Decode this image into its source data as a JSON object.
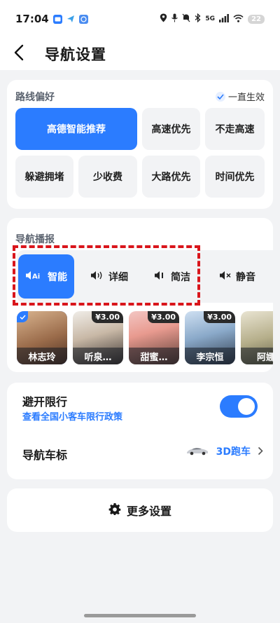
{
  "status": {
    "time": "17:04",
    "network": "5G",
    "battery": "22"
  },
  "header": {
    "title": "导航设置"
  },
  "route": {
    "section_title": "路线偏好",
    "always_on_label": "一直生效",
    "options": [
      {
        "label": "高德智能推荐",
        "active": true
      },
      {
        "label": "高速优先",
        "active": false
      },
      {
        "label": "不走高速",
        "active": false
      },
      {
        "label": "躲避拥堵",
        "active": false
      },
      {
        "label": "少收费",
        "active": false
      },
      {
        "label": "大路优先",
        "active": false
      },
      {
        "label": "时间优先",
        "active": false
      }
    ]
  },
  "broadcast": {
    "section_title": "导航播报",
    "modes": [
      {
        "label": "智能",
        "icon": "ai-speaker-icon",
        "active": true
      },
      {
        "label": "详细",
        "icon": "speaker-loud-icon",
        "active": false
      },
      {
        "label": "简洁",
        "icon": "speaker-low-icon",
        "active": false
      },
      {
        "label": "静音",
        "icon": "speaker-mute-icon",
        "active": false
      }
    ],
    "voices": [
      {
        "name": "林志玲",
        "price": "",
        "selected": true
      },
      {
        "name": "听泉…",
        "price": "¥3.00",
        "selected": false
      },
      {
        "name": "甜蜜…",
        "price": "¥3.00",
        "selected": false
      },
      {
        "name": "李宗恒",
        "price": "¥3.00",
        "selected": false
      },
      {
        "name": "阿娜",
        "price": "",
        "selected": false
      }
    ]
  },
  "settings": {
    "avoid_title": "避开限行",
    "policy_link": "查看全国小客车限行政策",
    "avoid_enabled": true,
    "car_label_title": "导航车标",
    "car_label_value": "3D跑车"
  },
  "more": {
    "label": "更多设置"
  },
  "colors": {
    "accent": "#2b7cff",
    "highlight_box": "#d9151b",
    "background": "#f2f3f5"
  }
}
